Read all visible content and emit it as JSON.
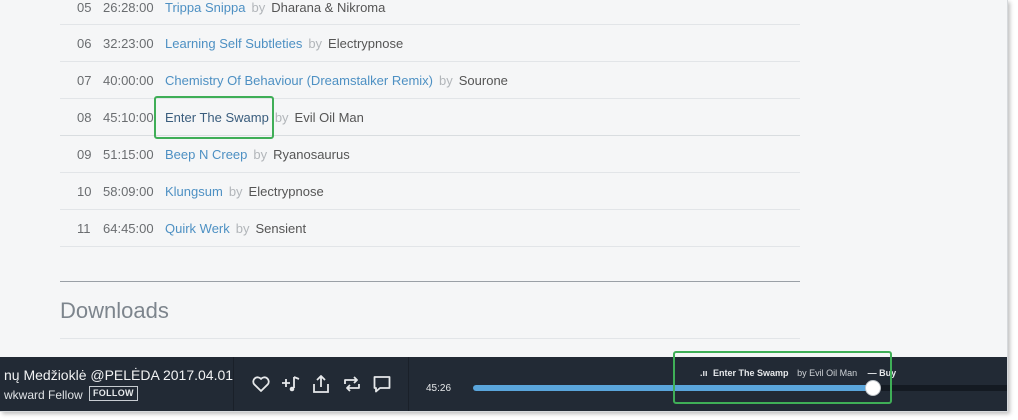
{
  "tracks": [
    {
      "num": "05",
      "time": "26:28:00",
      "title": "Trippa Snippa",
      "by": "by",
      "artist": "Dharana & Nikroma"
    },
    {
      "num": "06",
      "time": "32:23:00",
      "title": "Learning Self Subtleties",
      "by": "by",
      "artist": "Electrypnose"
    },
    {
      "num": "07",
      "time": "40:00:00",
      "title": "Chemistry Of Behaviour (Dreamstalker Remix)",
      "by": "by",
      "artist": "Sourone"
    },
    {
      "num": "08",
      "time": "45:10:00",
      "title": "Enter The Swamp",
      "by": "by",
      "artist": "Evil Oil Man"
    },
    {
      "num": "09",
      "time": "51:15:00",
      "title": "Beep N Creep",
      "by": "by",
      "artist": "Ryanosaurus"
    },
    {
      "num": "10",
      "time": "58:09:00",
      "title": "Klungsum",
      "by": "by",
      "artist": "Electrypnose"
    },
    {
      "num": "11",
      "time": "64:45:00",
      "title": "Quirk Werk",
      "by": "by",
      "artist": "Sensient"
    }
  ],
  "downloads": {
    "title": "Downloads"
  },
  "player": {
    "show_title": "nų Medžioklė @PELĖDA 2017.04.01",
    "show_artist": "wkward Fellow",
    "follow_label": "FOLLOW",
    "elapsed": "45:26",
    "eq_icon": ".ıı",
    "now_playing_title": "Enter The Swamp",
    "now_playing_by": "by Evil Oil Man",
    "buy_label": "— Buy",
    "progress": 0.74,
    "controls": [
      "heart-icon",
      "add-to-playlist-icon",
      "share-icon",
      "repost-icon",
      "comment-icon"
    ]
  },
  "colors": {
    "link": "#4d90c3",
    "player_bg": "#222a35",
    "progress_fill": "#5aa5db",
    "annotation": "#3fae57"
  }
}
